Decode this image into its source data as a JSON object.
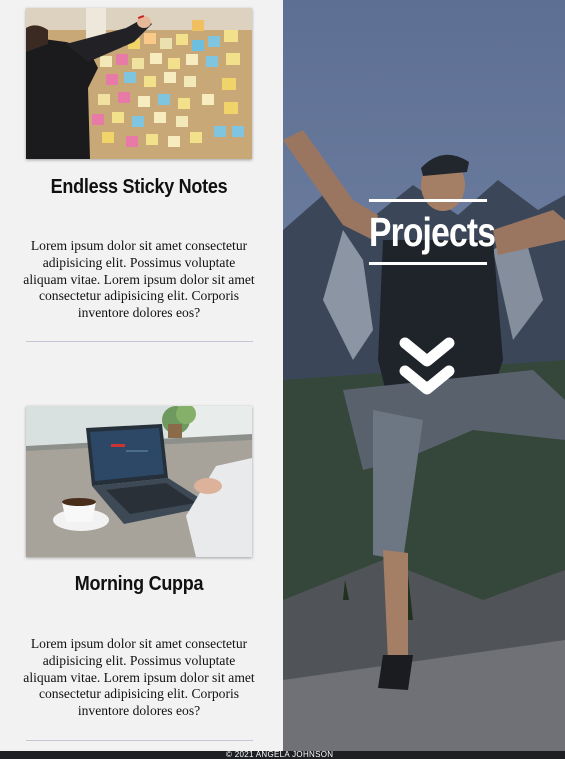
{
  "cards": [
    {
      "title": "Endless Sticky Notes",
      "image": "sticky-notes-photo",
      "text": "Lorem ipsum dolor sit amet consectetur adipisicing elit. Possimus voluptate aliquam vitae. Lorem ipsum dolor sit amet consectetur adipisicing elit. Corporis inventore dolores eos?"
    },
    {
      "title": "Morning Cuppa",
      "image": "laptop-coffee-photo",
      "text": "Lorem ipsum dolor sit amet consectetur adipisicing elit. Possimus voluptate aliquam vitae. Lorem ipsum dolor sit amet consectetur adipisicing elit. Corporis inventore dolores eos?"
    }
  ],
  "hero": {
    "title": "Projects",
    "icon": "double-chevron-down-icon",
    "image": "hiker-mountain-photo"
  },
  "footer": {
    "text": "© 2021 ANGELA JOHNSON"
  },
  "colors": {
    "background": "#f2f2f2",
    "footer": "#1e1f23",
    "divider": "#c5c6d6",
    "text": "#111111"
  }
}
